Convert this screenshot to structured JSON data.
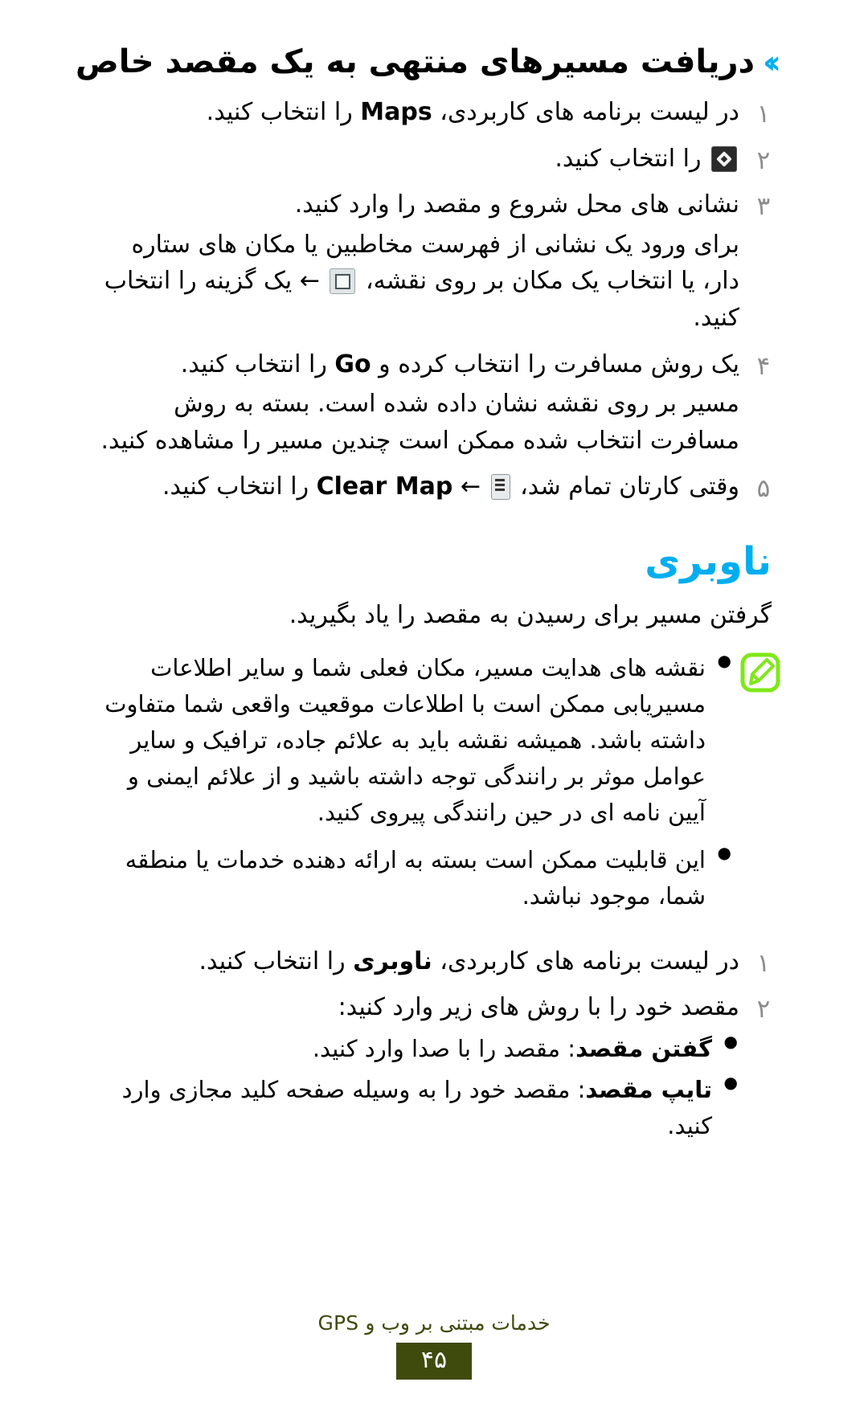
{
  "page": {
    "language": "fa",
    "direction": "rtl",
    "accent_blue": "#00AEEF",
    "note_green": "#7FE817",
    "footer_olive": "#3F4A0D",
    "number_gray": "#8C8C8C"
  },
  "section": {
    "chevrons": "››",
    "title": "دریافت مسیرهای منتهی به یک مقصد خاص"
  },
  "steps": [
    {
      "number": "۱",
      "before": "در لیست برنامه های کاربردی،",
      "bold": "Maps",
      "after": "را انتخاب کنید.",
      "icon": null
    },
    {
      "number": "۲",
      "before": "",
      "bold": "",
      "after": "را انتخاب کنید.",
      "icon": "navigation-arrow-icon"
    },
    {
      "number": "۳",
      "before": "نشانی های محل شروع و مقصد را وارد کنید.",
      "bold": "",
      "after": "",
      "icon": null,
      "extra_before": "برای ورود یک نشانی از فهرست مخاطبین یا مکان های ستاره دار، یا انتخاب یک مکان بر روی نقشه،",
      "extra_arrow": "←",
      "extra_after": "یک گزینه را انتخاب کنید.",
      "extra_icon": "map-layer-icon"
    },
    {
      "number": "۴",
      "before": "یک روش مسافرت را انتخاب کرده و",
      "bold": "Go",
      "after": "را انتخاب کنید.",
      "icon": null,
      "note_line_1": "مسیر بر روی نقشه نشان داده شده است. بسته به روش مسافرت انتخاب",
      "note_line_2": "شده ممکن است چندین مسیر را مشاهده کنید."
    },
    {
      "number": "۵",
      "before": "وقتی کارتان تمام شد،",
      "arrow": "←",
      "bold": "Clear Map",
      "after": "را انتخاب کنید.",
      "icon": "menu-options-icon"
    }
  ],
  "navigation": {
    "heading": "ناوبری",
    "lead": "گرفتن مسیر برای رسیدن به مقصد را یاد بگیرید.",
    "note_icon": "note-pencil-icon",
    "notes": [
      "نقشه های هدایت مسیر، مکان فعلی شما و سایر اطلاعات مسیریابی ممکن است با اطلاعات موقعیت واقعی شما متفاوت داشته باشد. همیشه نقشه باید به علائم جاده، ترافیک و سایر عوامل موثر بر رانندگی توجه داشته باشید و از علائم ایمنی و آیین نامه ای در حین رانندگی پیروی کنید.",
      "این قابلیت ممکن است بسته به ارائه دهنده خدمات یا منطقه شما، موجود نباشد."
    ]
  },
  "nav_steps": [
    {
      "number": "۱",
      "before": "در لیست برنامه های کاربردی،",
      "bold": "ناوبری",
      "after": "را انتخاب کنید."
    },
    {
      "number": "۲",
      "before": "مقصد خود را با روش های زیر وارد کنید:",
      "bold": "",
      "after": ""
    }
  ],
  "nav_sub_items": [
    {
      "bold": "گفتن مقصد",
      "text": ": مقصد را با صدا وارد کنید."
    },
    {
      "bold": "تایپ مقصد",
      "text": ": مقصد خود را به وسیله صفحه کلید مجازی وارد کنید."
    }
  ],
  "footer": {
    "text": "خدمات مبتنی بر وب و GPS",
    "page_number": "۴۵"
  }
}
